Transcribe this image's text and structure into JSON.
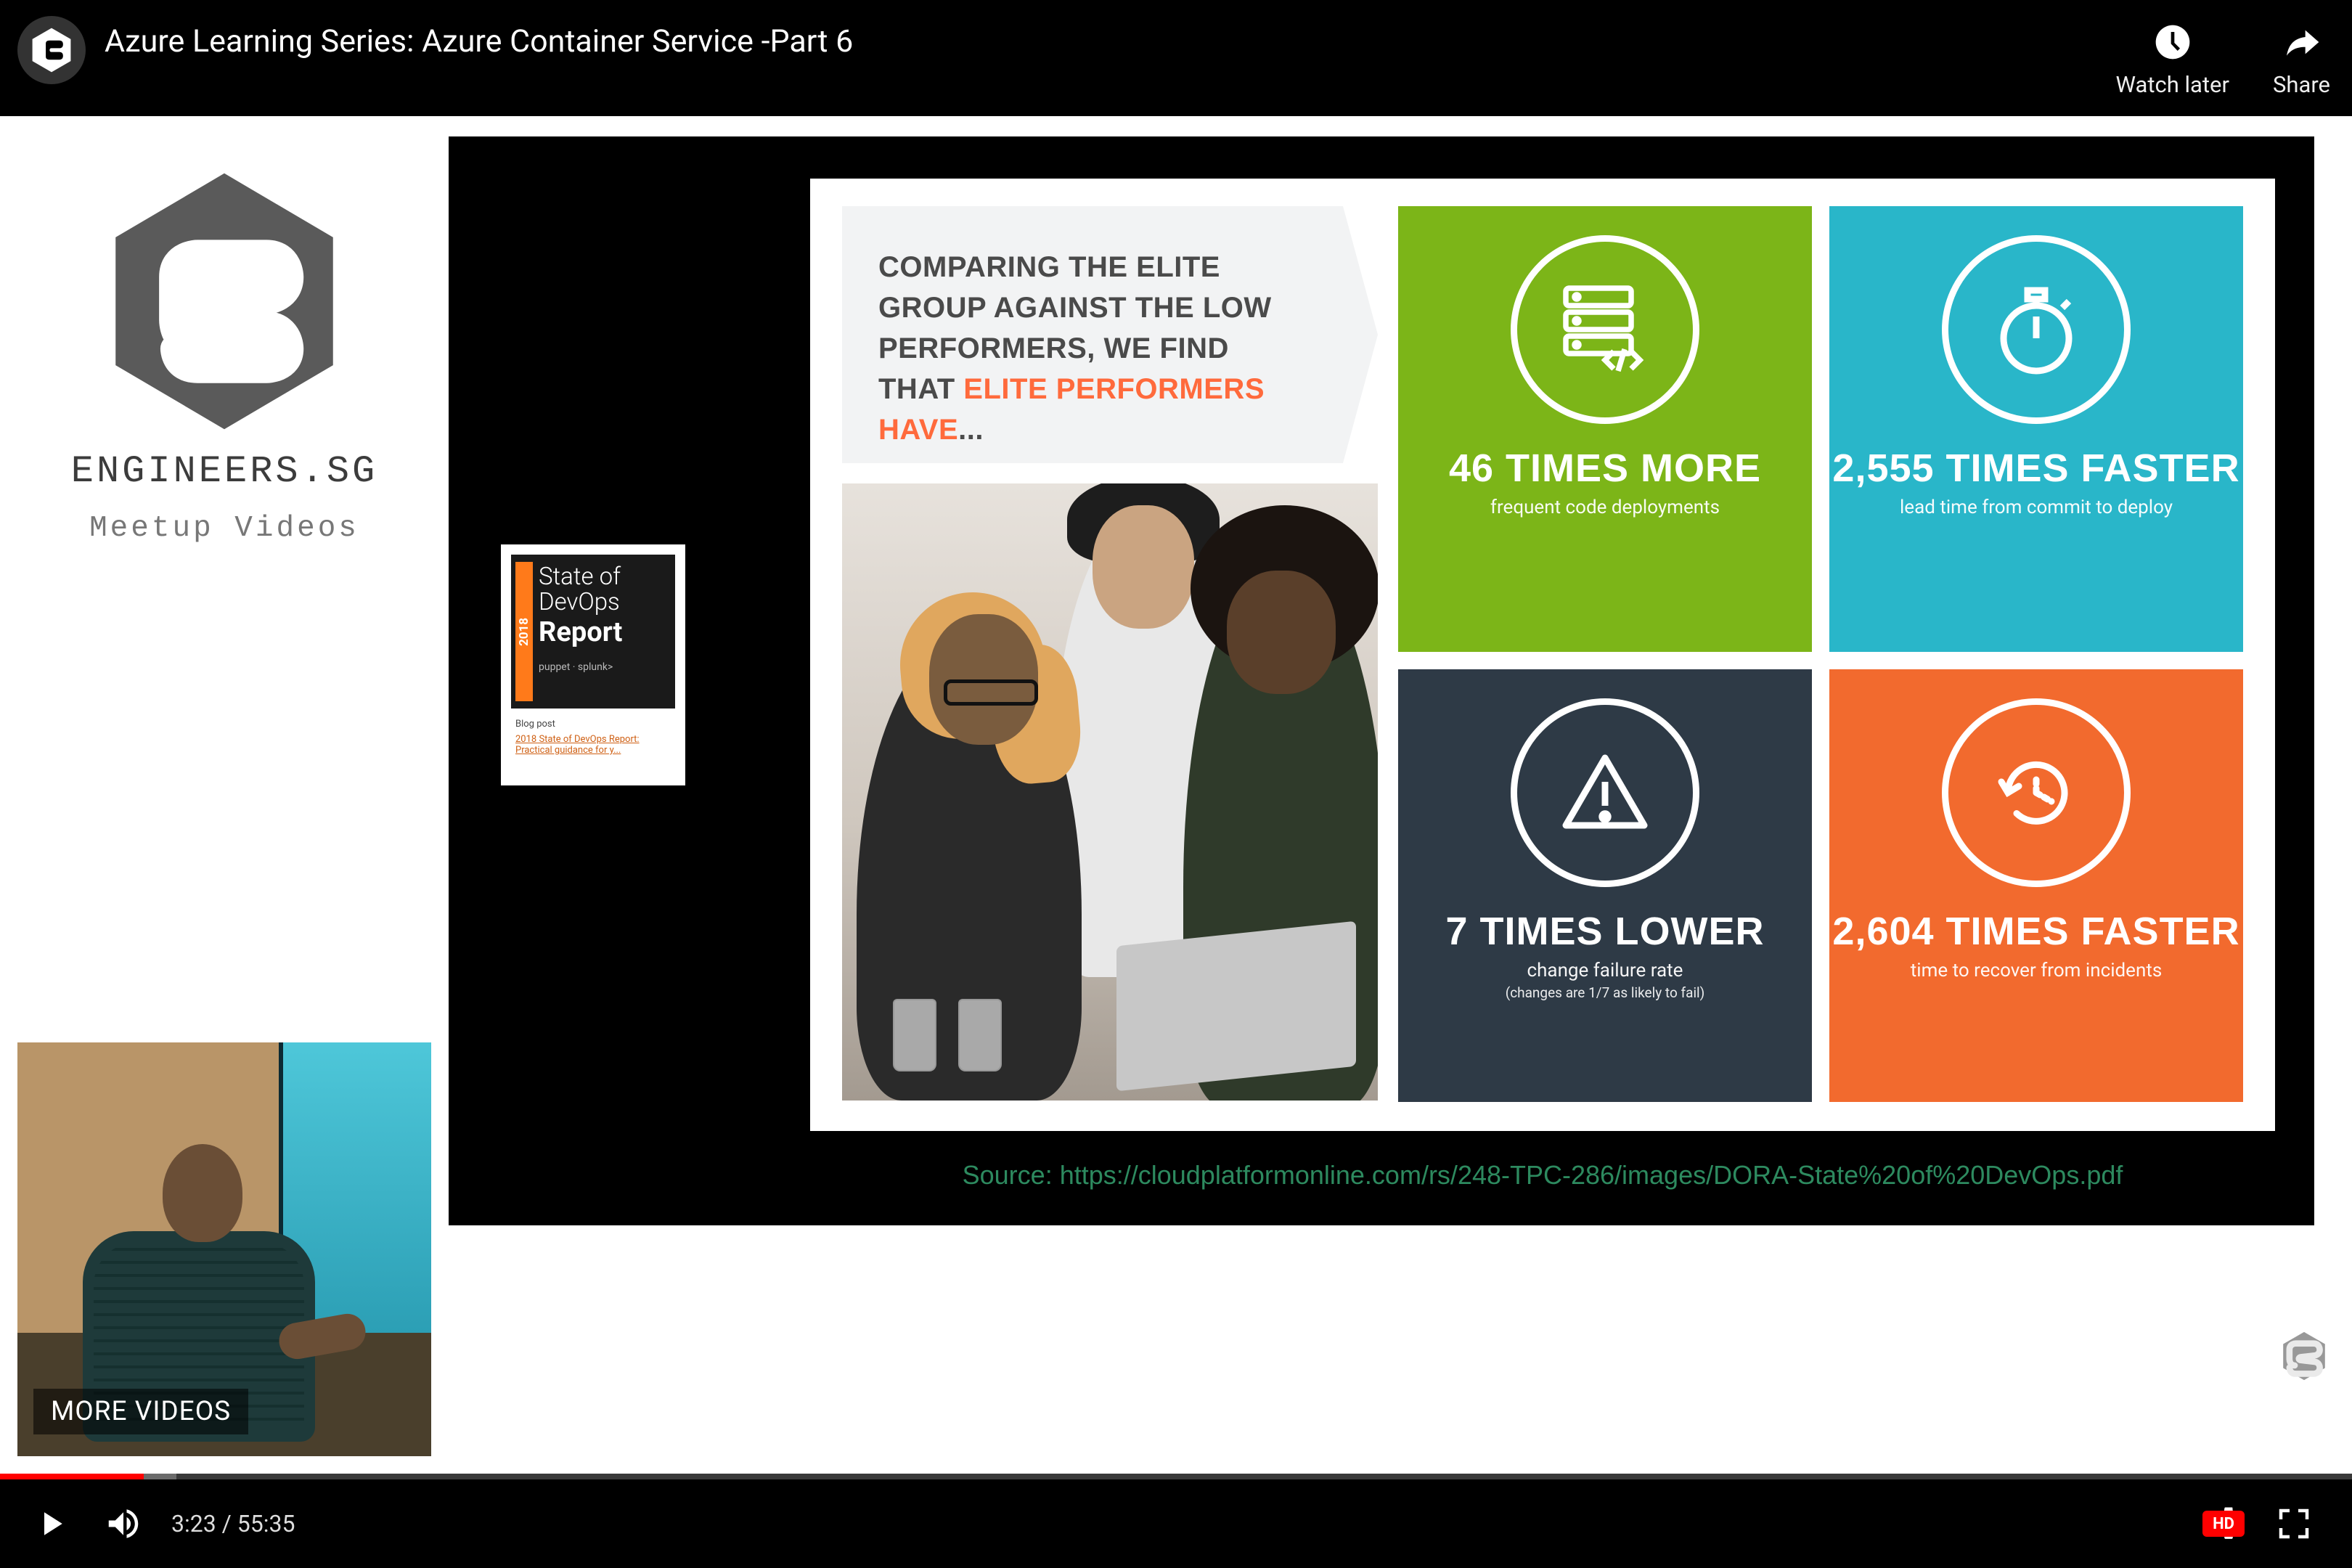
{
  "header": {
    "video_title": "Azure Learning Series: Azure Container Service -Part 6",
    "watch_later": "Watch later",
    "share": "Share"
  },
  "brand": {
    "title": "ENGINEERS.SG",
    "subtitle": "Meetup Videos"
  },
  "pip": {
    "more_videos": "MORE VIDEOS"
  },
  "devops_card": {
    "year": "2018",
    "line1": "State of",
    "line2": "DevOps",
    "line3": "Report",
    "brands": "puppet · splunk>",
    "blog_label": "Blog post",
    "blog_link": "2018 State of DevOps Report: Practical guidance for y..."
  },
  "infographic": {
    "heading_pre": "COMPARING THE ELITE GROUP AGAINST THE LOW PERFORMERS, WE FIND THAT",
    "heading_hl": "ELITE PERFORMERS HAVE",
    "heading_ellipsis": "...",
    "tiles": [
      {
        "big": "46 TIMES MORE",
        "small": "frequent code deployments",
        "tiny": ""
      },
      {
        "big": "2,555 TIMES FASTER",
        "small": "lead time from commit to deploy",
        "tiny": ""
      },
      {
        "big": "7 TIMES LOWER",
        "small": "change failure rate",
        "tiny": "(changes are 1/7 as likely to fail)"
      },
      {
        "big": "2,604 TIMES FASTER",
        "small": "time to recover from incidents",
        "tiny": ""
      }
    ],
    "source": "Source: https://cloudplatformonline.com/rs/248-TPC-286/images/DORA-State%20of%20DevOps.pdf"
  },
  "player": {
    "current_time": "3:23",
    "duration": "55:35",
    "separator": " / ",
    "hd_label": "HD"
  }
}
